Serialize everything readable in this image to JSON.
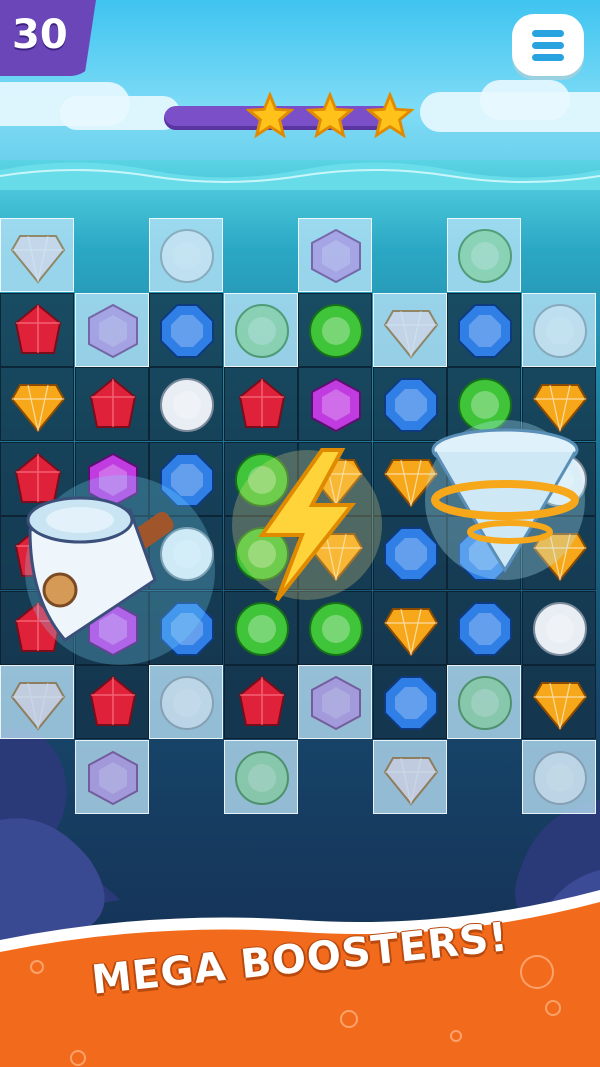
{
  "hud": {
    "moves": "30",
    "stars_earned": 3,
    "stars_total": 3,
    "menu_icon": "hamburger-menu-icon"
  },
  "board": {
    "columns": 8,
    "rows": 8,
    "cells": [
      [
        "ice:diamond-white",
        "empty",
        "ice:round-white",
        "empty",
        "ice:hex-purple",
        "empty",
        "ice:round-green",
        "empty"
      ],
      [
        "red",
        "ice:hex-purple",
        "blue",
        "ice:round-green",
        "green",
        "ice:diamond-white",
        "blue",
        "ice:round-white"
      ],
      [
        "yellow",
        "red",
        "white",
        "red",
        "purple",
        "blue",
        "green",
        "yellow"
      ],
      [
        "red",
        "purple",
        "blue",
        "green",
        "yellow",
        "yellow",
        "blue",
        "white"
      ],
      [
        "red",
        "purple",
        "white",
        "green",
        "yellow",
        "blue",
        "blue",
        "yellow"
      ],
      [
        "red",
        "purple",
        "blue",
        "green",
        "green",
        "yellow",
        "blue",
        "white"
      ],
      [
        "ice:diamond-white",
        "red",
        "ice:round-white",
        "red",
        "ice:hex-purple",
        "blue",
        "ice:round-green",
        "yellow"
      ],
      [
        "empty",
        "ice:hex-purple",
        "empty",
        "ice:round-green",
        "empty",
        "ice:diamond-white",
        "empty",
        "ice:round-white"
      ]
    ]
  },
  "boosters": [
    {
      "name": "hammer",
      "icon": "hammer-icon"
    },
    {
      "name": "lightning",
      "icon": "lightning-bolt-icon"
    },
    {
      "name": "tornado",
      "icon": "tornado-icon"
    }
  ],
  "banner": {
    "text": "MEGA BOOSTERS!"
  },
  "colors": {
    "red": "#e0213a",
    "blue": "#2f7fe6",
    "green": "#3fc43a",
    "purple": "#c13ce0",
    "yellow": "#f6a81a",
    "white": "#e8eef4",
    "banner_orange": "#f26a1b",
    "hud_purple": "#6b46b8"
  }
}
